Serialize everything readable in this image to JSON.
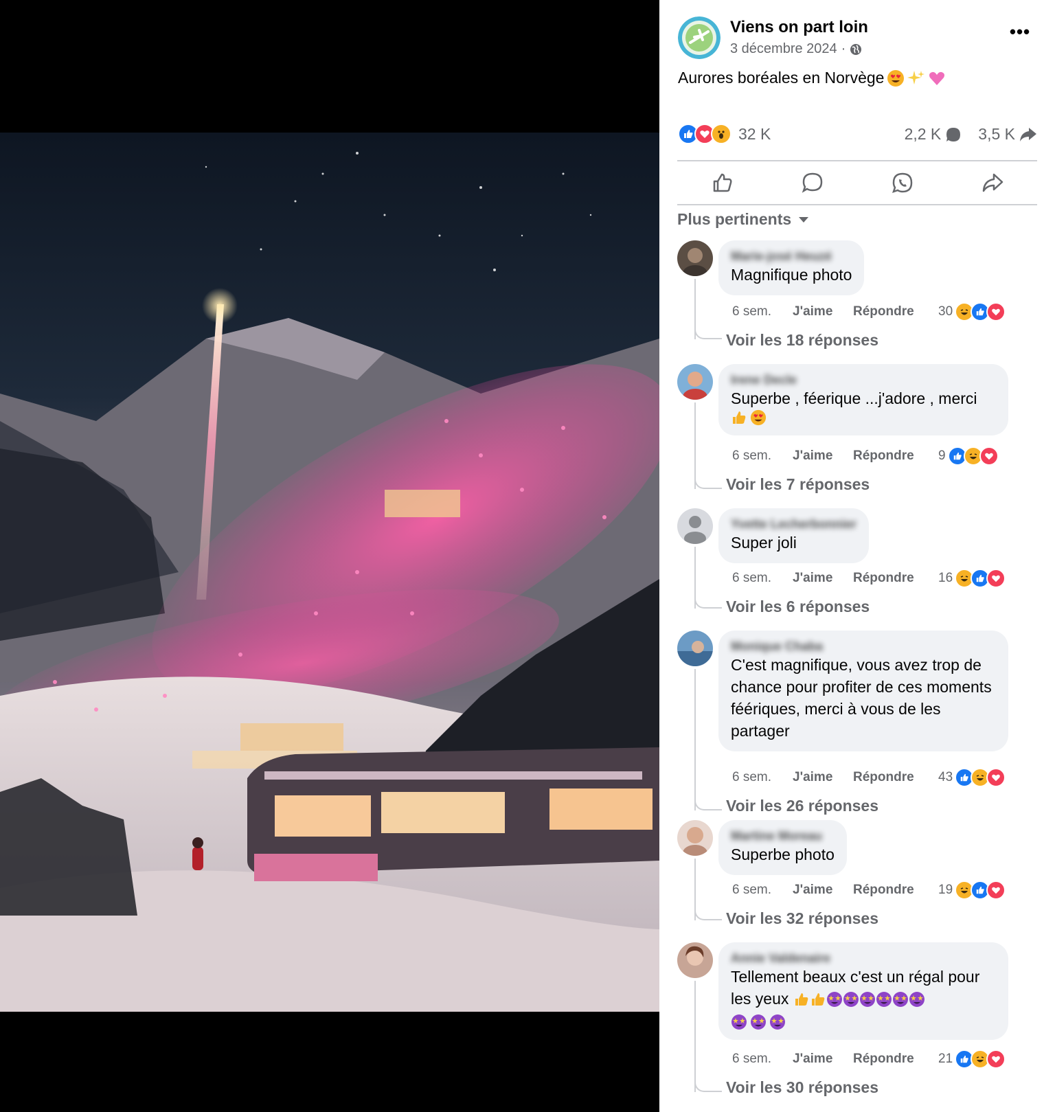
{
  "post": {
    "page_name": "Viens on part loin",
    "date": "3 décembre 2024",
    "separator": "·",
    "audience_icon": "globe-icon",
    "caption": "Aurores boréales en Norvège",
    "caption_emojis": [
      "heart-eyes",
      "sparkles",
      "pink-heart"
    ],
    "reactions": {
      "types": [
        "like",
        "love",
        "wow"
      ],
      "count": "32 K"
    },
    "comments_count": "2,2 K",
    "shares_count": "3,5 K",
    "actions": [
      "like-icon",
      "comment-icon",
      "whatsapp-icon",
      "share-icon"
    ],
    "sort_label": "Plus pertinents"
  },
  "colors": {
    "like_blue": "#1877f2",
    "love_red": "#f33e58",
    "haha_yellow": "#f7b125",
    "secondary_text": "#65676b",
    "bubble_bg": "#f0f2f5"
  },
  "comments": [
    {
      "author": "Marie-josé Heuzé",
      "text": "Magnifique photo",
      "age": "6 sem.",
      "like": "J'aime",
      "reply": "Répondre",
      "reaction_count": "30",
      "reactions": [
        "haha",
        "like",
        "love"
      ],
      "replies": "Voir les 18 réponses"
    },
    {
      "author": "Irene Decle",
      "text": "Superbe , féerique ...j'adore , merci",
      "text_emojis": [
        "thumbs-up",
        "heart-eyes"
      ],
      "age": "6 sem.",
      "like": "J'aime",
      "reply": "Répondre",
      "reaction_count": "9",
      "reactions": [
        "like",
        "haha",
        "love"
      ],
      "replies": "Voir les 7 réponses"
    },
    {
      "author": "Yvette Lecherbonnier",
      "text": "Super joli",
      "age": "6 sem.",
      "like": "J'aime",
      "reply": "Répondre",
      "reaction_count": "16",
      "reactions": [
        "haha",
        "like",
        "love"
      ],
      "replies": "Voir les 6 réponses"
    },
    {
      "author": "Monique Chaba",
      "text": "C'est magnifique, vous avez trop de chance pour profiter de ces moments féériques, merci à vous de les partager",
      "age": "6 sem.",
      "like": "J'aime",
      "reply": "Répondre",
      "reaction_count": "43",
      "reactions": [
        "like",
        "haha",
        "love"
      ],
      "replies": "Voir les 26 réponses"
    },
    {
      "author": "Martine Moreau",
      "text": "Superbe photo",
      "age": "6 sem.",
      "like": "J'aime",
      "reply": "Répondre",
      "reaction_count": "19",
      "reactions": [
        "haha",
        "like",
        "love"
      ],
      "replies": "Voir les 32 réponses"
    },
    {
      "author": "Annie Valdenaire",
      "text": "Tellement beaux c'est un régal pour les yeux",
      "text_emojis": [
        "thumbs-up",
        "thumbs-up",
        "star-struck",
        "star-struck",
        "star-struck",
        "star-struck",
        "star-struck",
        "star-struck",
        "star-struck",
        "star-struck",
        "star-struck"
      ],
      "age": "6 sem.",
      "like": "J'aime",
      "reply": "Répondre",
      "reaction_count": "21",
      "reactions": [
        "like",
        "haha",
        "love"
      ],
      "replies": "Voir les 30 réponses"
    }
  ]
}
